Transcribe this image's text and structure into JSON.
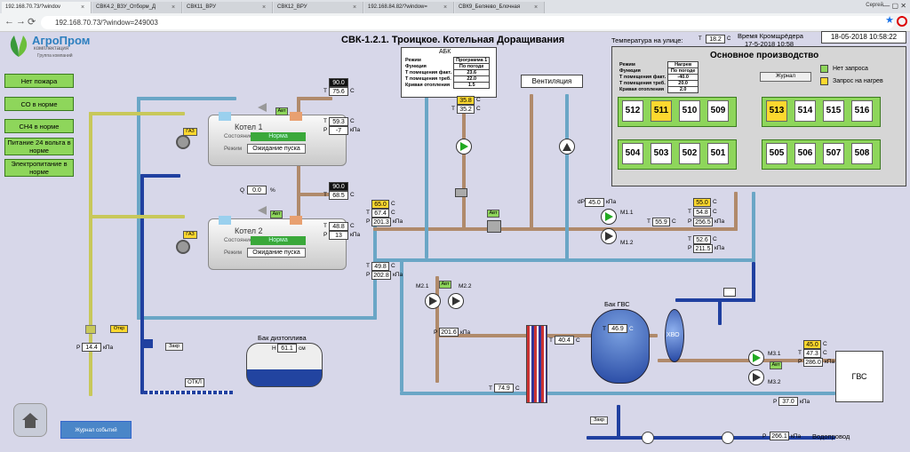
{
  "browser": {
    "tabs": [
      "192.168.70.73/?windov",
      "СВК4.2_ВЗУ_Отборм_Д",
      "СВК11_ВРУ",
      "СВК12_ВРУ",
      "192.168.84.82/?window=",
      "СВК9_Беляево_Блочная"
    ],
    "user": "Сергей",
    "url": "192.168.70.73/?window=249003"
  },
  "header": {
    "logo_name": "АгроПром",
    "logo_sub": "комплектация",
    "logo_group": "Группа компаний",
    "title": "СВК-1.2.1. Троицкое. Котельная Доращивания",
    "outdoor_label": "Температура на улице:",
    "outdoor_t": "T",
    "outdoor_value": "18.2",
    "outdoor_unit": "С",
    "kromsh_label": "Время Кромщрёдера",
    "kromsh_value": "17-5-2018 10:58",
    "datetime": "18-05-2018 10:58:22"
  },
  "status_buttons": [
    "Нет пожара",
    "СО в норме",
    "СН4 в норме",
    "Питание 24 вольта в норме",
    "Электропитание в норме"
  ],
  "abk": {
    "title": "АБК",
    "rows": [
      {
        "label": "Режим",
        "value": "Программа 1"
      },
      {
        "label": "Функция",
        "value": "По погоде"
      },
      {
        "label": "T помещения факт.",
        "value": "23.6"
      },
      {
        "label": "T помещения треб.",
        "value": "22.0"
      },
      {
        "label": "Кривая отопления",
        "value": "1.5"
      }
    ]
  },
  "ventilation": "Вентиляция",
  "production": {
    "title": "Основное производство",
    "rows": [
      {
        "label": "Режим",
        "value": "Нагрев"
      },
      {
        "label": "Функция",
        "value": "По погоде"
      },
      {
        "label": "T помещения факт.",
        "value": "-40.0"
      },
      {
        "label": "T помещения треб.",
        "value": "20.0"
      },
      {
        "label": "Кривая отопления",
        "value": "2.0"
      }
    ],
    "journal": "Журнал",
    "legend_green": "Нет запроса",
    "legend_yellow": "Запрос на нагрев",
    "group1_top": [
      {
        "n": "512",
        "y": false
      },
      {
        "n": "511",
        "y": true
      },
      {
        "n": "510",
        "y": false
      },
      {
        "n": "509",
        "y": false
      }
    ],
    "group1_bot": [
      {
        "n": "504",
        "y": false
      },
      {
        "n": "503",
        "y": false
      },
      {
        "n": "502",
        "y": false
      },
      {
        "n": "501",
        "y": false
      }
    ],
    "group2_top": [
      {
        "n": "513",
        "y": true
      },
      {
        "n": "514",
        "y": false
      },
      {
        "n": "515",
        "y": false
      },
      {
        "n": "516",
        "y": false
      }
    ],
    "group2_bot": [
      {
        "n": "505",
        "y": false
      },
      {
        "n": "506",
        "y": false
      },
      {
        "n": "507",
        "y": false
      },
      {
        "n": "508",
        "y": false
      }
    ]
  },
  "boiler1": {
    "name": "Котел 1",
    "state_label": "Состояние",
    "state": "Норма",
    "mode_label": "Режим",
    "mode": "Ожидание пуска",
    "setpoint": "90.0",
    "t_out": "75.6",
    "t_in": "59.3",
    "p": "-7"
  },
  "boiler2": {
    "name": "Котел 2",
    "state_label": "Состояние",
    "state": "Норма",
    "mode_label": "Режим",
    "mode": "Ожидание пуска",
    "setpoint": "90.0",
    "t_out": "68.5",
    "t_in": "48.8",
    "p": "13"
  },
  "gas": "ГАЗ",
  "avt": "Авт",
  "otkr": "Откр",
  "zakr": "Закр",
  "otkl": "ОТКЛ",
  "q_label": "Q",
  "q_value": "0.0",
  "q_unit": "%",
  "units": {
    "c": "С",
    "kpa": "кПа",
    "sm": "см"
  },
  "t_lbl": "T",
  "p_lbl": "P",
  "n_lbl": "H",
  "common": {
    "sp": "65.0",
    "t": "67.4",
    "p": "201.3",
    "t_ret": "49.8",
    "p_ret": "202.8"
  },
  "abk_circuit": {
    "sp": "35.8",
    "t": "35.2"
  },
  "m1": {
    "lbl1": "М1.1",
    "lbl2": "М1.2",
    "dp": "45.0",
    "t": "55.9",
    "sp": "55.0",
    "t2": "54.8",
    "p2": "256.5",
    "t3": "52.6",
    "p3": "211.5",
    "dp_lbl": "dP"
  },
  "m2": {
    "lbl1": "М2.1",
    "lbl2": "М2.2",
    "p": "201.6"
  },
  "gvs_tank": {
    "name": "Бак ГВС",
    "t": "46.9",
    "t_hx": "40.4",
    "t_low": "74.9"
  },
  "hvo": "ХВО",
  "m3": {
    "lbl1": "М3.1",
    "lbl2": "М3.2",
    "sp": "45.0",
    "t": "47.3",
    "p": "286.0"
  },
  "gvs": {
    "name": "ГВС",
    "p": "37.0"
  },
  "water": {
    "label": "Водопровод",
    "p": "266.1"
  },
  "diesel": {
    "name": "Бак дизтоплива",
    "level": "61.1"
  },
  "gas_p": "14.4",
  "journal_events": "Журнал событий"
}
